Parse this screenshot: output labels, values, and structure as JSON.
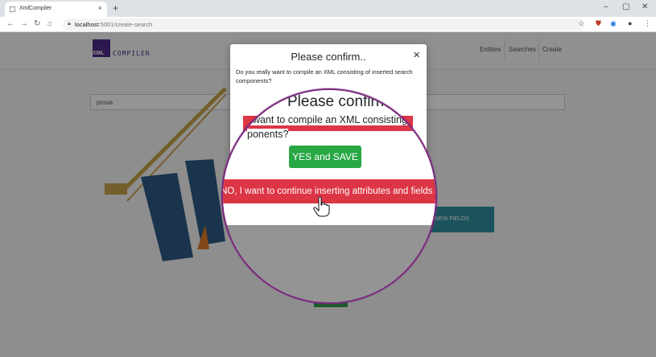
{
  "browser": {
    "tab_title": "XmlCompiler",
    "url_host": "localhost",
    "url_path": ":5001/create-search",
    "new_tab_label": "+",
    "tab_close": "×"
  },
  "navbar": {
    "logo_badge": "XML",
    "logo_word": "COMPILER",
    "links": [
      "Entities",
      "Searches",
      "Create"
    ]
  },
  "page": {
    "search_value": "prova",
    "new_fields_button": "NEW FIELDS"
  },
  "modal": {
    "title": "Please confirm..",
    "close": "×",
    "body": "Do you really want to compile an XML consisting of inserted search components?"
  },
  "magnifier": {
    "title": "Please confirm..",
    "body_line1": "I want to compile an XML consisting",
    "body_line2": "ponents?",
    "yes_button": "YES and SAVE",
    "no_button": "NO, I want to continue inserting attributes and fields"
  },
  "colors": {
    "danger": "#dc3545",
    "success": "#28a745",
    "brand": "#4b2a86",
    "lens_border": "#7a2a7e"
  }
}
